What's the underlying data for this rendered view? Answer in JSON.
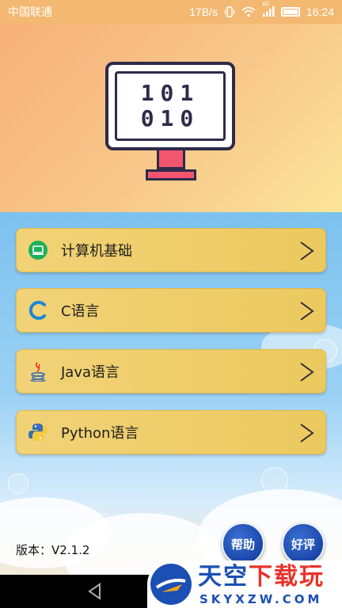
{
  "status_bar": {
    "carrier": "中国联通",
    "speed": "17B/s",
    "network": "4G",
    "time": "16:24"
  },
  "hero": {
    "monitor_line1": "101",
    "monitor_line2": "010",
    "colors": {
      "screen_outline": "#2e2a4a",
      "stand": "#f2566e"
    }
  },
  "menu": {
    "items": [
      {
        "label": "计算机基础",
        "icon": "laptop-icon"
      },
      {
        "label": "C语言",
        "icon": "c-language-icon"
      },
      {
        "label": "Java语言",
        "icon": "java-coffee-icon"
      },
      {
        "label": "Python语言",
        "icon": "python-icon"
      }
    ],
    "arrow_icon": "chevron-right-icon"
  },
  "footer": {
    "version": "版本：V2.1.2",
    "help_label": "帮助",
    "rate_label": "好评"
  },
  "watermark": {
    "title_main": "天空",
    "title_accent": "下载玩",
    "subtitle": "SKYXZW.COM"
  },
  "colors": {
    "menu_bg": "#ecc95f",
    "button_blue": "#1b46a8",
    "status_bar": "#f3b872"
  }
}
